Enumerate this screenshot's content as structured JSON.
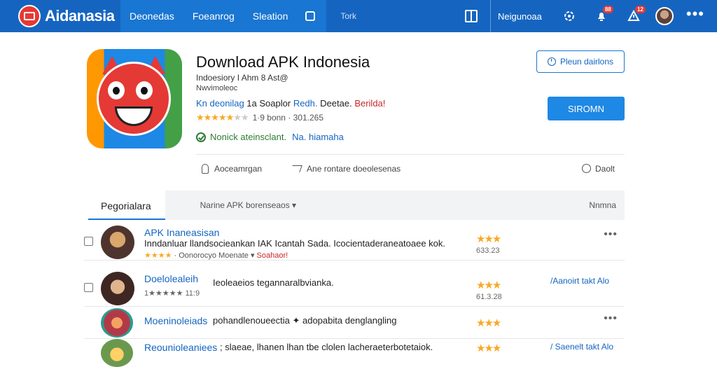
{
  "topbar": {
    "brand": "Aidanasia",
    "nav": [
      "Deonedas",
      "Foeanrog",
      "Sleation"
    ],
    "nav_extra": "Tork",
    "user_label": "Neigunoaa",
    "badge_1": "88",
    "badge_2": "12",
    "more": "•••"
  },
  "app": {
    "title": "Download APK Indonesia",
    "developer": "Indoesiory I Ahm 8 Ast@",
    "subtitle": "Nwvimoleoc",
    "meta_blue": "Kn deonilag",
    "meta_mid": "1a Soaplor",
    "meta_blue2": "Redh.",
    "meta_end": "Deetae.",
    "meta_red": "Berilda!",
    "rating_text": "1·9 bonn · 301.265",
    "verified": "Nonick ateinsclant.",
    "verified_extra": "Na. hiamaha",
    "btn_secondary": "Pleun dairlons",
    "btn_primary": "SIROMN",
    "actions": [
      "Aoceamrgan",
      "Ane rontare doeolesenas",
      "Daolt"
    ]
  },
  "list": {
    "tab_active": "Pegorialara",
    "filter": "Narine APK borenseaos ▾",
    "sort": "Nnmna",
    "rows": [
      {
        "name": "APK Inaneasisan",
        "desc": "Inndanluar llandsocieankan IAK Icantah Sada. Icocientaderaneatoaee kok.",
        "meta_text": "Oonorocyo Moenate ▾",
        "meta_red": "Soahaor!",
        "stars": "★★★",
        "rating": "633.23",
        "link": "",
        "dots": "•••"
      },
      {
        "name": "Doelolealeih",
        "desc": "1★★★★★ 11:9",
        "inline": "Ieoleaeios tegannaralbvianka.",
        "meta_text": "",
        "meta_red": "",
        "stars": "★★★",
        "rating": "61.3.28",
        "link": "/Aanoirt takt Alo",
        "dots": ""
      },
      {
        "name": "Moeninoleiads",
        "desc": "",
        "inline": "pohandlenoueectia  ✦ adopabita denglangling",
        "meta_text": "",
        "meta_red": "",
        "stars": "★★★",
        "rating": "",
        "link": "",
        "dots": "•••"
      },
      {
        "name": "Reounioleaniees",
        "desc": "",
        "inline": "; slaeae, lhanen lhan tbe clolen lacheraeterbotetaiok.",
        "meta_text": "",
        "meta_red": "",
        "stars": "★★★",
        "rating": "",
        "link": "/ Saenelt takt Alo",
        "dots": ""
      }
    ]
  },
  "colors": {
    "topbar": "#1565c0",
    "accent": "#1e88e5",
    "link": "#1565c0",
    "star": "#f9a825",
    "danger": "#c62828",
    "verified": "#2e7d32"
  }
}
